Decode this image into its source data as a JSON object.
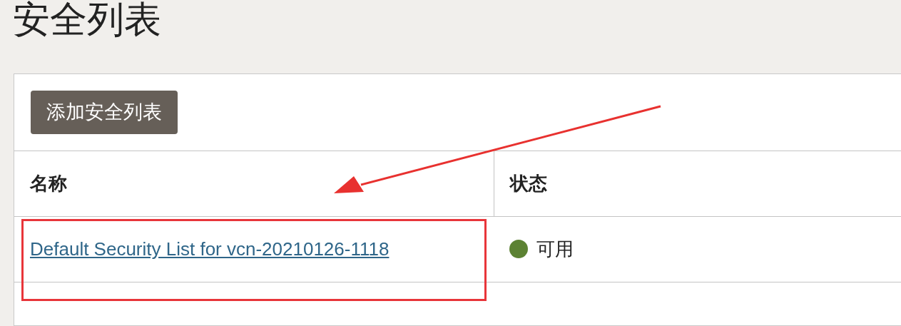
{
  "page_title": "安全列表",
  "add_button": {
    "label": "添加安全列表"
  },
  "table": {
    "columns": [
      {
        "label": "名称"
      },
      {
        "label": "状态"
      }
    ],
    "rows": [
      {
        "name": "Default Security List for vcn-20210126-1118",
        "status": {
          "label": "可用",
          "color": "#5c8233"
        }
      }
    ]
  }
}
